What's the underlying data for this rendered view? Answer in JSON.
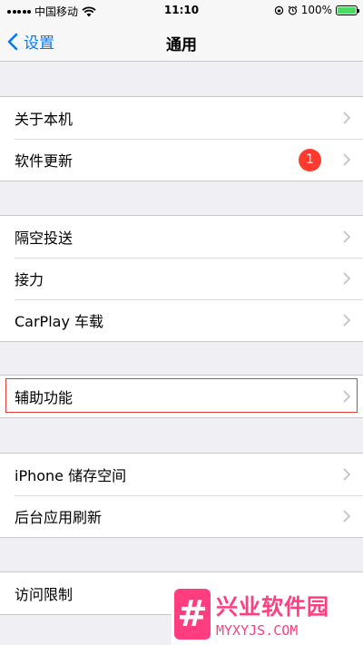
{
  "status_bar": {
    "carrier": "中国移动",
    "time": "11:10",
    "battery_percent": "100%"
  },
  "nav": {
    "back_label": "设置",
    "title": "通用"
  },
  "groups": [
    {
      "rows": [
        {
          "label": "关于本机"
        },
        {
          "label": "软件更新",
          "badge": "1"
        }
      ]
    },
    {
      "rows": [
        {
          "label": "隔空投送"
        },
        {
          "label": "接力"
        },
        {
          "label": "CarPlay 车载"
        }
      ]
    },
    {
      "rows": [
        {
          "label": "辅助功能",
          "highlighted": true
        }
      ]
    },
    {
      "rows": [
        {
          "label": "iPhone 储存空间"
        },
        {
          "label": "后台应用刷新"
        }
      ]
    },
    {
      "rows": [
        {
          "label": "访问限制"
        }
      ]
    }
  ],
  "watermark": {
    "title": "兴业软件园",
    "url": "MYXYJS.COM"
  },
  "colors": {
    "accent": "#007aff",
    "badge": "#ff3b30",
    "battery": "#4cd964",
    "highlight": "#e53935",
    "watermark": "#ff3d7f"
  }
}
